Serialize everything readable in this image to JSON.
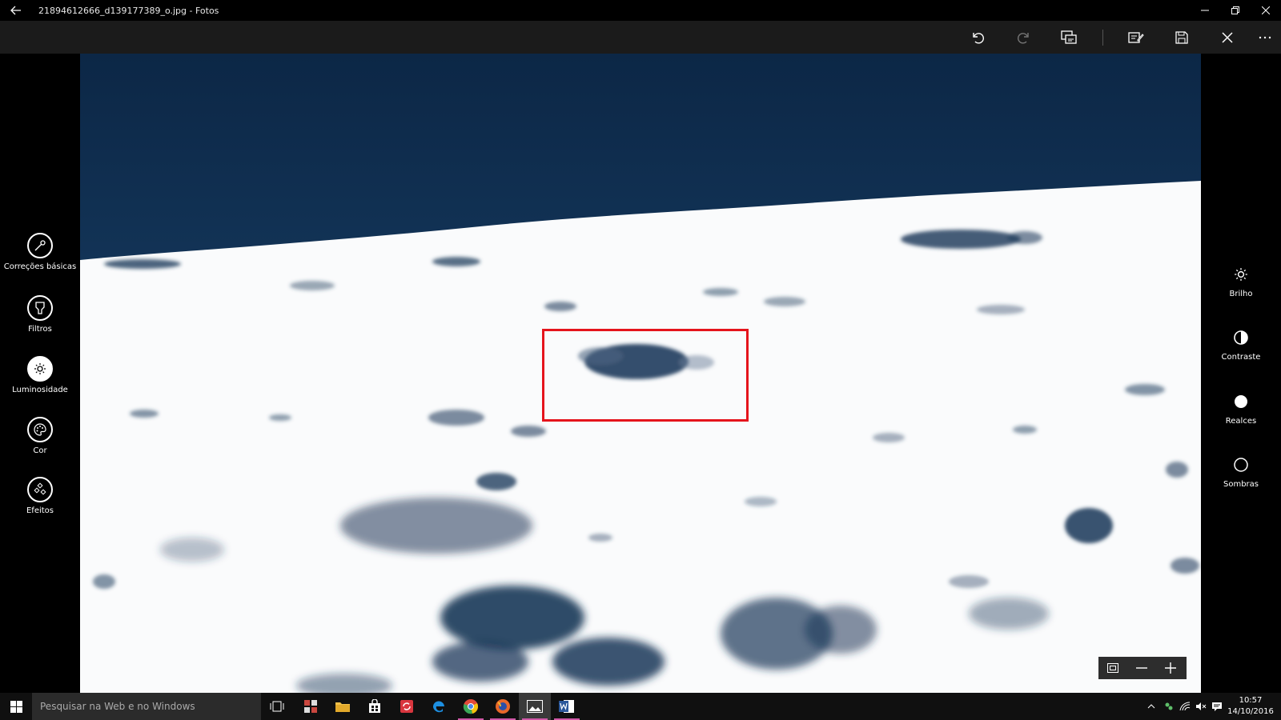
{
  "window": {
    "title": "21894612666_d139177389_o.jpg - Fotos"
  },
  "toolbar": {
    "icons": [
      "undo-icon",
      "redo-icon",
      "compare-icon",
      "save-copy-icon",
      "save-icon",
      "close-icon",
      "more-icon"
    ]
  },
  "left_tools": [
    {
      "label": "Correções básicas",
      "icon": "wand-icon"
    },
    {
      "label": "Filtros",
      "icon": "filter-icon"
    },
    {
      "label": "Luminosidade",
      "icon": "brightness-icon"
    },
    {
      "label": "Cor",
      "icon": "palette-icon"
    },
    {
      "label": "Efeitos",
      "icon": "effects-icon"
    }
  ],
  "right_adjustments": [
    {
      "label": "Brilho",
      "icon": "brightness-icon"
    },
    {
      "label": "Contraste",
      "icon": "contrast-icon"
    },
    {
      "label": "Realces",
      "icon": "highlights-icon"
    },
    {
      "label": "Sombras",
      "icon": "shadows-icon"
    }
  ],
  "taskbar": {
    "search_placeholder": "Pesquisar na Web e no Windows",
    "time": "10:57",
    "date": "14/10/2016"
  },
  "colors": {
    "accent_active_tool": "#ffffff",
    "highlight_box": "#e5141c",
    "sky": "#0f2c4c",
    "shadow_tone": "#1e3a5c",
    "taskbar_underline": "#d058a8"
  }
}
